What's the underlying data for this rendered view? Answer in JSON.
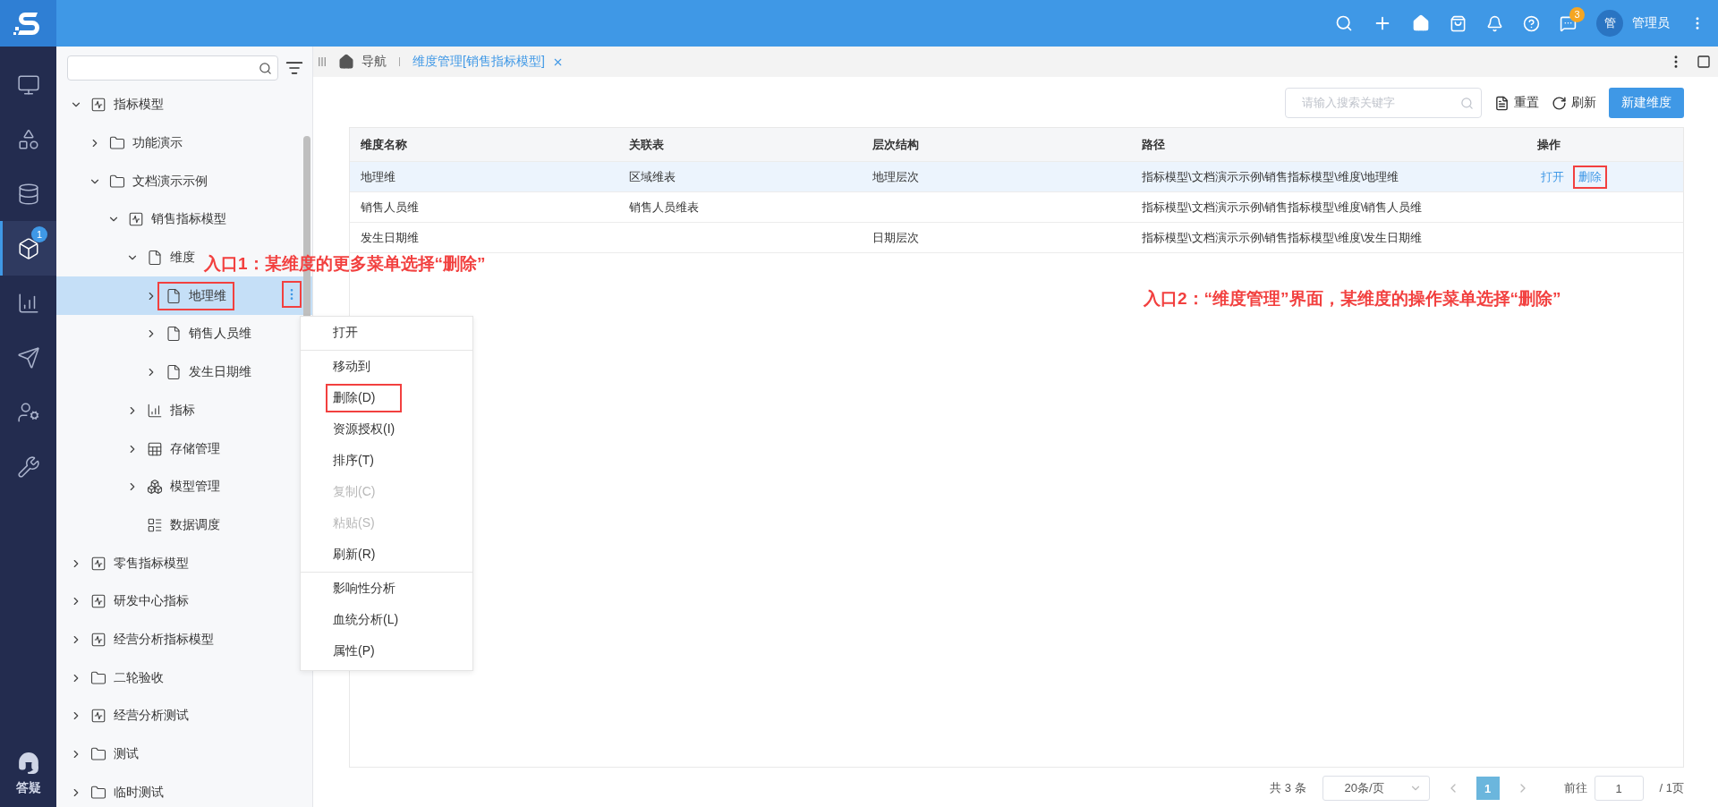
{
  "topbar": {
    "chat_badge": "3",
    "avatar": "管",
    "user": "管理员"
  },
  "nav": {
    "items": [
      {
        "kind": "monitor",
        "selected": false
      },
      {
        "kind": "widgets",
        "selected": false
      },
      {
        "kind": "database",
        "selected": false
      },
      {
        "kind": "cube",
        "selected": true,
        "badge": "1"
      },
      {
        "kind": "chart",
        "selected": false
      },
      {
        "kind": "send",
        "selected": false
      },
      {
        "kind": "usergear",
        "selected": false
      },
      {
        "kind": "tools",
        "selected": false
      }
    ],
    "help": "答疑"
  },
  "tree": {
    "items": [
      {
        "label": "指标模型",
        "kind": "model",
        "expanded": true,
        "selected": false,
        "boxed": false,
        "children": [
          {
            "label": "功能演示",
            "kind": "folder",
            "expanded": false,
            "selected": false,
            "boxed": false
          },
          {
            "label": "文档演示示例",
            "kind": "folder",
            "expanded": true,
            "selected": false,
            "boxed": false,
            "children": [
              {
                "label": "销售指标模型",
                "kind": "model",
                "expanded": true,
                "selected": false,
                "boxed": false,
                "children": [
                  {
                    "label": "维度",
                    "kind": "dimension",
                    "expanded": true,
                    "selected": false,
                    "boxed": false,
                    "children": [
                      {
                        "label": "地理维",
                        "kind": "dimension",
                        "expanded": false,
                        "selected": true,
                        "boxed": true
                      },
                      {
                        "label": "销售人员维",
                        "kind": "dimension",
                        "expanded": false,
                        "selected": false,
                        "boxed": false
                      },
                      {
                        "label": "发生日期维",
                        "kind": "dimension",
                        "expanded": false,
                        "selected": false,
                        "boxed": false
                      }
                    ]
                  },
                  {
                    "label": "指标",
                    "kind": "metric",
                    "expanded": false,
                    "selected": false,
                    "boxed": false
                  },
                  {
                    "label": "存储管理",
                    "kind": "storage",
                    "expanded": false,
                    "selected": false,
                    "boxed": false
                  },
                  {
                    "label": "模型管理",
                    "kind": "cube",
                    "expanded": false,
                    "selected": false,
                    "boxed": false
                  },
                  {
                    "label": "数据调度",
                    "kind": "schedule",
                    "selected": false,
                    "boxed": false
                  }
                ]
              }
            ]
          }
        ]
      },
      {
        "label": "零售指标模型",
        "kind": "model",
        "expanded": false,
        "selected": false,
        "boxed": false
      },
      {
        "label": "研发中心指标",
        "kind": "model",
        "expanded": false,
        "selected": false,
        "boxed": false
      },
      {
        "label": "经营分析指标模型",
        "kind": "model",
        "expanded": false,
        "selected": false,
        "boxed": false
      },
      {
        "label": "二轮验收",
        "kind": "folder",
        "expanded": false,
        "selected": false,
        "boxed": false
      },
      {
        "label": "经营分析测试",
        "kind": "model",
        "expanded": false,
        "selected": false,
        "boxed": false
      },
      {
        "label": "测试",
        "kind": "folder",
        "expanded": false,
        "selected": false,
        "boxed": false
      },
      {
        "label": "临时测试",
        "kind": "folder",
        "expanded": false,
        "selected": false,
        "boxed": false
      }
    ]
  },
  "context_menu": {
    "items": [
      {
        "label": "打开",
        "disabled": false,
        "boxed": false,
        "separated": false
      },
      {
        "label": "移动到",
        "disabled": false,
        "boxed": false,
        "separated": true
      },
      {
        "label": "删除(D)",
        "disabled": false,
        "boxed": true,
        "separated": false
      },
      {
        "label": "资源授权(I)",
        "disabled": false,
        "boxed": false,
        "separated": false
      },
      {
        "label": "排序(T)",
        "disabled": false,
        "boxed": false,
        "separated": false
      },
      {
        "label": "复制(C)",
        "disabled": true,
        "boxed": false,
        "separated": false
      },
      {
        "label": "粘贴(S)",
        "disabled": true,
        "boxed": false,
        "separated": false
      },
      {
        "label": "刷新(R)",
        "disabled": false,
        "boxed": false,
        "separated": false
      },
      {
        "label": "影响性分析",
        "disabled": false,
        "boxed": false,
        "separated": true
      },
      {
        "label": "血统分析(L)",
        "disabled": false,
        "boxed": false,
        "separated": false
      },
      {
        "label": "属性(P)",
        "disabled": false,
        "boxed": false,
        "separated": false
      }
    ]
  },
  "tabs": [
    {
      "label": "导航",
      "kind": "home",
      "selected": false
    },
    {
      "label": "维度管理[销售指标模型]",
      "kind": "page",
      "selected": true
    }
  ],
  "toolbar": {
    "search_placeholder": "请输入搜索关键字",
    "reset": "重置",
    "refresh": "刷新",
    "create": "新建维度"
  },
  "table": {
    "columns": [
      "维度名称",
      "关联表",
      "层次结构",
      "路径",
      "操作"
    ],
    "rows": [
      {
        "cells": [
          "地理维",
          "区域维表",
          "地理层次",
          "指标模型\\文档演示示例\\销售指标模型\\维度\\地理维"
        ],
        "selected": true,
        "actions": [
          {
            "label": "打开",
            "boxed": false
          },
          {
            "label": "删除",
            "boxed": true
          }
        ]
      },
      {
        "cells": [
          "销售人员维",
          "销售人员维表",
          "",
          "指标模型\\文档演示示例\\销售指标模型\\维度\\销售人员维"
        ],
        "selected": false,
        "actions": []
      },
      {
        "cells": [
          "发生日期维",
          "",
          "日期层次",
          "指标模型\\文档演示示例\\销售指标模型\\维度\\发生日期维"
        ],
        "selected": false,
        "actions": []
      }
    ]
  },
  "pagination": {
    "total": "共 3 条",
    "page_size": "20条/页",
    "pages": [
      {
        "label": "1",
        "selected": true
      }
    ],
    "goto_label": "前往",
    "goto_value": "1",
    "page_count": "/ 1页"
  },
  "annotations": [
    {
      "text": "入口1：某维度的更多菜单选择“删除”"
    },
    {
      "text": "入口2：“维度管理”界面，某维度的操作菜单选择“删除”"
    }
  ]
}
